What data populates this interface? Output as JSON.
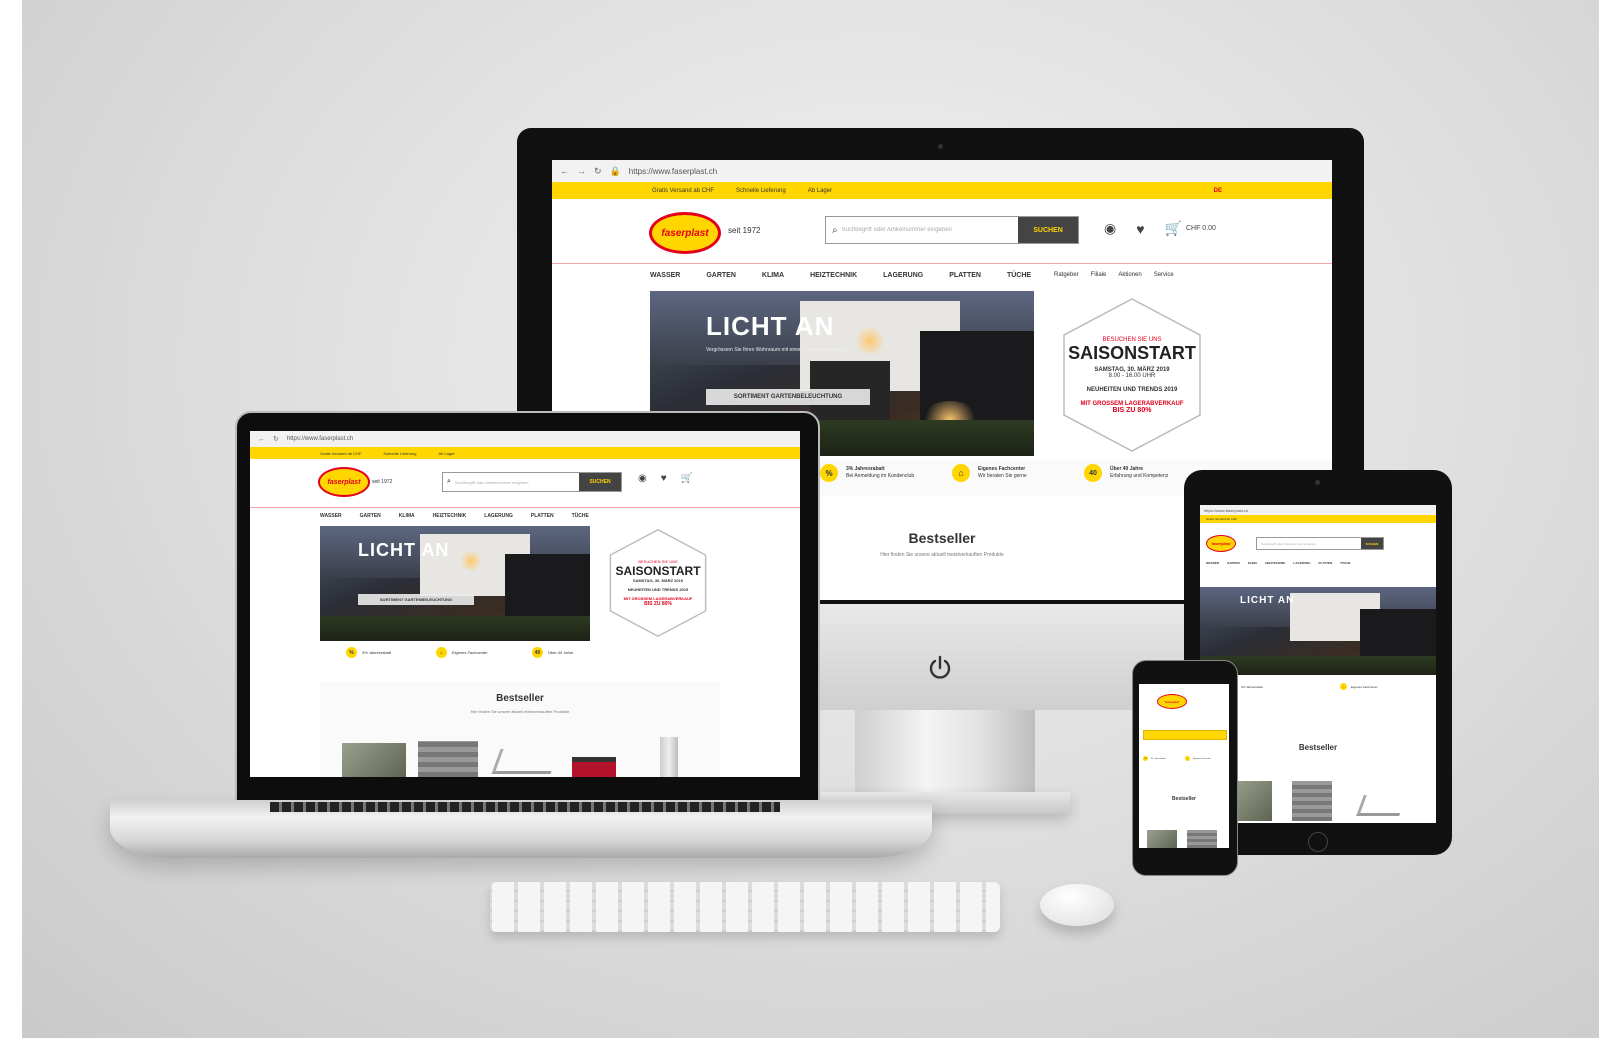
{
  "site": {
    "url": "https://www.faserplast.ch",
    "topbar_left": "Gratis Versand ab CHF",
    "topbar_mid": "Schnelle Lieferung",
    "topbar_right": "Ab Lager",
    "lang": "DE",
    "logo": "faserplast",
    "since": "seit 1972",
    "search_placeholder": "Suchbegriff oder Artikelnummer eingeben",
    "search_button": "SUCHEN",
    "cart": "CHF 0.00"
  },
  "nav": [
    "WASSER",
    "GARTEN",
    "KLIMA",
    "HEIZTECHNIK",
    "LAGERUNG",
    "PLATTEN",
    "TÜCHE"
  ],
  "nav_links": [
    "Ratgeber",
    "Filiale",
    "Aktionen",
    "Service"
  ],
  "hero": {
    "title": "LICHT AN",
    "subtitle": "Vergrössern Sie Ihren Wohnraum mit einer Gartenbeleuchtung.",
    "cta": "SORTIMENT GARTENBELEUCHTUNG"
  },
  "promo": {
    "line1": "BESUCHEN SIE UNS",
    "line2": "SAISONSTART",
    "line3": "SAMSTAG, 30. MÄRZ 2019",
    "line4": "8.00 - 16.00 UHR",
    "line5": "NEUHEITEN UND TRENDS 2019",
    "line6": "MIT GROSSEM LAGERABVERKAUF",
    "line7": "BIS ZU 80%"
  },
  "usps": [
    {
      "icon": "%",
      "title": "3% Jahresrabatt",
      "text": "Bei Anmeldung im Kundenclub"
    },
    {
      "icon": "⌂",
      "title": "Eigenes Fachcenter",
      "text": "Wir beraten Sie gerne"
    },
    {
      "icon": "40",
      "title": "Über 40 Jahre",
      "text": "Erfahrung und Kompetenz"
    }
  ],
  "bestseller": {
    "title": "Bestseller",
    "subtitle": "Hier finden Sie unsere aktuell meistverkauften Produkte"
  },
  "colors": {
    "brand_yellow": "#ffd600",
    "brand_red": "#e3001b",
    "dark": "#333333"
  }
}
